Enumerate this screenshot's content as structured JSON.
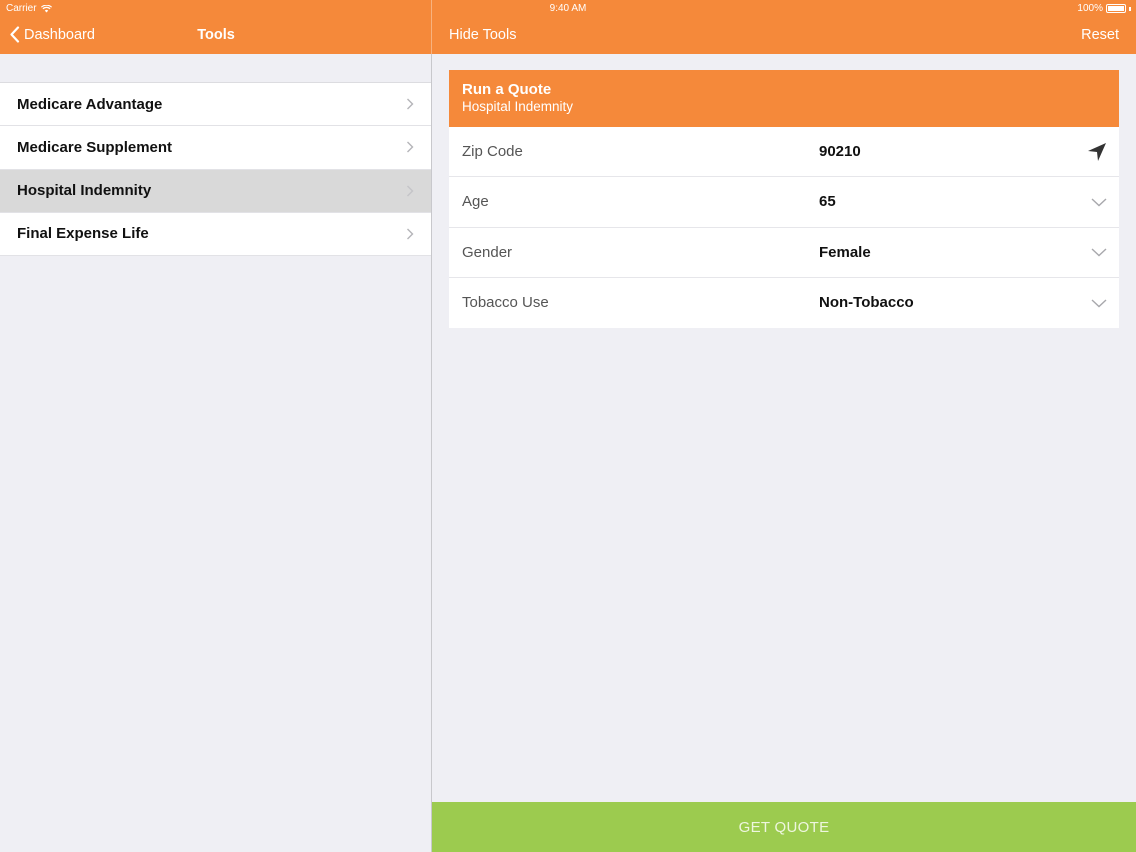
{
  "status_bar": {
    "carrier": "Carrier",
    "time": "9:40 AM",
    "battery": "100%"
  },
  "nav": {
    "back_label": "Dashboard",
    "left_title": "Tools",
    "hide_tools_label": "Hide Tools",
    "reset_label": "Reset"
  },
  "sidebar": {
    "items": [
      {
        "label": "Medicare Advantage",
        "selected": false
      },
      {
        "label": "Medicare Supplement",
        "selected": false
      },
      {
        "label": "Hospital Indemnity",
        "selected": true
      },
      {
        "label": "Final Expense Life",
        "selected": false
      }
    ]
  },
  "quote_card": {
    "title": "Run a Quote",
    "subtitle": "Hospital Indemnity",
    "fields": [
      {
        "label": "Zip Code",
        "value": "90210",
        "icon": "location-arrow-icon"
      },
      {
        "label": "Age",
        "value": "65",
        "icon": "chevron-down-icon"
      },
      {
        "label": "Gender",
        "value": "Female",
        "icon": "chevron-down-icon"
      },
      {
        "label": "Tobacco Use",
        "value": "Non-Tobacco",
        "icon": "chevron-down-icon"
      }
    ]
  },
  "footer": {
    "get_quote_label": "GET QUOTE"
  },
  "colors": {
    "accent": "#f5893a",
    "action": "#9ccb4f",
    "background": "#efeff4",
    "selected_row": "#d9d9d9"
  }
}
